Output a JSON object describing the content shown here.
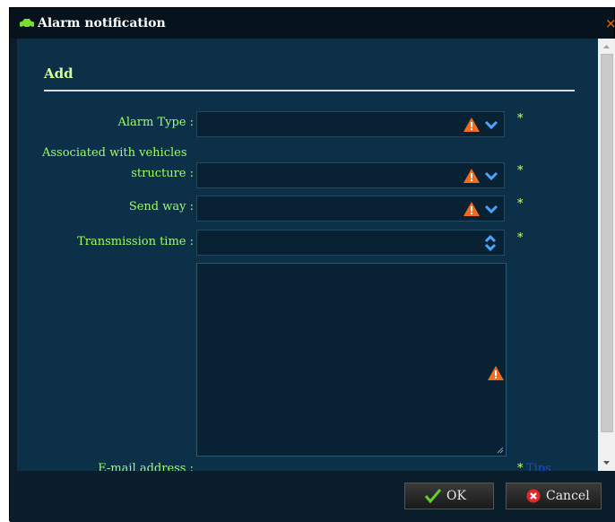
{
  "dialog": {
    "title": "Alarm notification",
    "icon": "car-icon",
    "close_glyph": "×"
  },
  "form": {
    "section_title": "Add",
    "fields": [
      {
        "label": "Alarm Type :",
        "value": "",
        "required": "*"
      },
      {
        "label_line1": "Associated with vehicles",
        "label_line2": "structure :",
        "value": "",
        "required": "*"
      },
      {
        "label": "Send way :",
        "value": "",
        "required": "*"
      },
      {
        "label": "Transmission time :",
        "value": "",
        "required": "*"
      },
      {
        "label": "E-mail address :",
        "value": "",
        "required": "*",
        "tips": "Tips"
      }
    ]
  },
  "buttons": {
    "ok": "OK",
    "cancel": "Cancel"
  },
  "colors": {
    "label": "#9dff62",
    "warning": "#f26b21",
    "chevron": "#4aa3ff",
    "background": "#0d3049"
  }
}
